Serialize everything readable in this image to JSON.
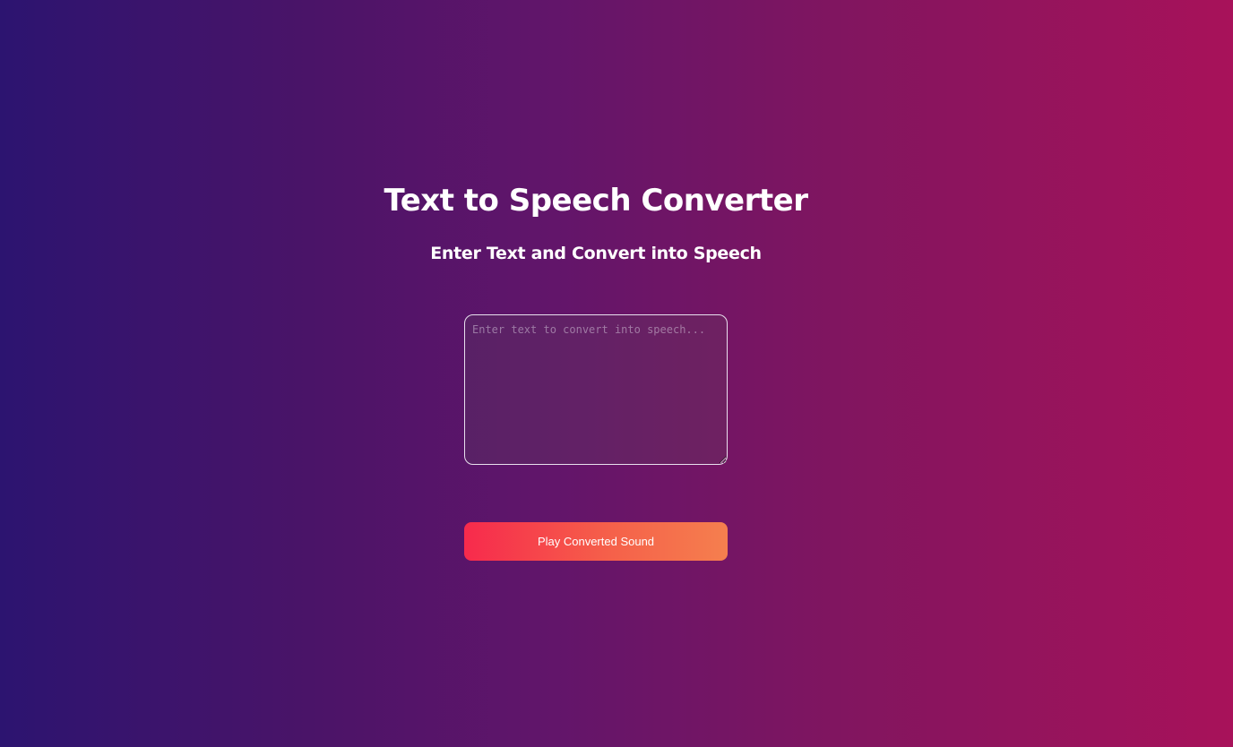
{
  "header": {
    "title": "Text to Speech Converter",
    "subtitle": "Enter Text and Convert into Speech"
  },
  "input": {
    "value": "",
    "placeholder": "Enter text to convert into speech..."
  },
  "actions": {
    "play_label": "Play Converted Sound"
  },
  "colors": {
    "background_start": "#2c1470",
    "background_end": "#a8125a",
    "button_start": "#f72a4c",
    "button_end": "#f57f4e"
  }
}
